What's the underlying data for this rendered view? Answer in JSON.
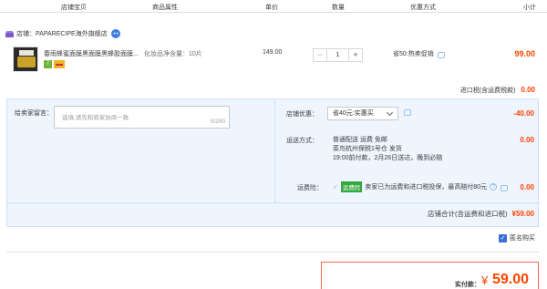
{
  "columns": [
    "店铺宝贝",
    "商品属性",
    "单价",
    "数量",
    "优惠方式",
    "小计"
  ],
  "shop": {
    "label": "店铺：",
    "name": "PAPARECIPE海外旗舰店"
  },
  "item": {
    "title": "春雨蜂蜜面膜黑面膜黑蜂胶面膜...",
    "badge_number": "7",
    "attribute": "化妆品净含量：10片",
    "price": "149.00",
    "quantity": "1",
    "promotion": "省50:热卖促销",
    "subtotal": "99.00"
  },
  "import_tax": {
    "label": "进口税(含运费税款)",
    "value": "0.00"
  },
  "message": {
    "label": "给卖家留言：",
    "placeholder": "选填,请先和商家协商一致",
    "counter": "0/200"
  },
  "shop_discount": {
    "label": "店铺优惠：",
    "selected": "省40元:实惠买",
    "amount": "-40.00"
  },
  "shipping": {
    "label": "运送方式：",
    "line1": "普通配送 运费 免邮",
    "line2": "菜鸟杭州保税1号仓   发货",
    "line3": "19:00前付款，2月26日送达，晚到必赔",
    "amount": "0.00"
  },
  "insurance": {
    "label": "运费险：",
    "tag": "运费险",
    "text": "卖家已为运费和进口税投保，最高赔付80元",
    "amount": "0.00"
  },
  "shop_total": {
    "label": "店铺合计(含运费和进口税)",
    "value": "¥59.00"
  },
  "anonymous": {
    "label": "匿名购买",
    "checked": true
  },
  "payment": {
    "label": "实付款：",
    "currency": "¥",
    "total": "59.00"
  },
  "colors": {
    "accent": "#ff4400",
    "panel": "#eef5ff",
    "checkbox": "#3a6fd8",
    "insurance_tag": "#32a83e"
  }
}
